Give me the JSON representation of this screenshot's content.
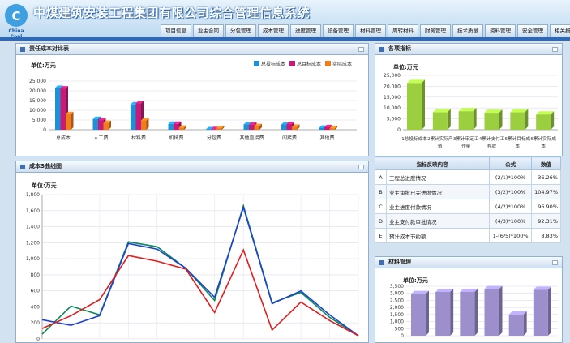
{
  "app": {
    "title": "中煤建筑安装工程集团有限公司综合管理信息系统",
    "logo_text": "China Coal"
  },
  "nav": {
    "tabs": [
      "项目信息",
      "业主合同",
      "分包管理",
      "成本管理",
      "进度管理",
      "设备管理",
      "材料管理",
      "周转材料",
      "财务管理",
      "技术质量",
      "资料管理",
      "安全管理",
      "相关报表"
    ]
  },
  "panels": {
    "cost_compare": {
      "title": "责任成本对比表",
      "unit": "单位:万元"
    },
    "indicators": {
      "title": "各项指标",
      "unit": "单位:万元"
    },
    "scurve": {
      "title": "成本S曲线图",
      "unit": "单位:万元"
    },
    "materials": {
      "title": "材料管理",
      "unit": "单位:万元"
    }
  },
  "table": {
    "headers": [
      "指标反映内容",
      "公式",
      "数值"
    ],
    "rows": [
      [
        "A",
        "工程总进度情况",
        "(2/1)*100%",
        "36.26%"
      ],
      [
        "B",
        "业主审批已完进度情况",
        "(3/2)*100%",
        "104.97%"
      ],
      [
        "C",
        "业主进度付款情况",
        "(4/2)*100%",
        "96.90%"
      ],
      [
        "D",
        "业主支付款审批情况",
        "(4/3)*100%",
        "92.31%"
      ],
      [
        "E",
        "预计成本节约额",
        "1-(6/5)*100%",
        "8.83%"
      ]
    ]
  },
  "chart_data": [
    {
      "type": "bar",
      "legend": [
        "总投标成本",
        "总目标成本",
        "实际成本"
      ],
      "colors": [
        "#1e90d6",
        "#c81a78",
        "#f07c1e"
      ],
      "categories": [
        "总成本",
        "人工费",
        "材料费",
        "机械费",
        "分包费",
        "其他直接费",
        "间接费",
        "其他费"
      ],
      "series": [
        {
          "name": "总投标成本",
          "values": [
            21500,
            5500,
            13000,
            3000,
            200,
            2700,
            2700,
            1000
          ]
        },
        {
          "name": "总目标成本",
          "values": [
            21200,
            4800,
            13600,
            3000,
            300,
            2500,
            2900,
            1300
          ]
        },
        {
          "name": "实际成本",
          "values": [
            8000,
            3500,
            4800,
            1000,
            800,
            1800,
            1500,
            800
          ]
        }
      ],
      "yticks": [
        "0",
        "5,000",
        "10,000",
        "15,000",
        "20,000",
        "25,000"
      ],
      "ylim": [
        0,
        25000
      ]
    },
    {
      "type": "bar",
      "categories": [
        "1总投标成本",
        "2累计实际产值",
        "3累计审定工作量",
        "4累计支付工程款",
        "5累计目标成本",
        "6累计实际成本"
      ],
      "values": [
        21500,
        8000,
        8500,
        7800,
        8000,
        7000
      ],
      "yticks": [
        "0",
        "5,000",
        "10,000",
        "15,000",
        "20,000",
        "25,000"
      ],
      "ylim": [
        0,
        25000
      ],
      "color": "#9ccf3f"
    },
    {
      "type": "line",
      "yticks": [
        "0",
        "200",
        "400",
        "600",
        "800",
        "1,000",
        "1,200",
        "1,400",
        "1,600",
        "1,800"
      ],
      "ylim": [
        0,
        1800
      ],
      "series": [
        {
          "color": "#0a8a55",
          "values": [
            60,
            410,
            300,
            1210,
            1150,
            880,
            480,
            1660,
            450,
            580,
            270,
            40
          ]
        },
        {
          "color": "#2040d0",
          "values": [
            240,
            170,
            290,
            1190,
            1120,
            880,
            520,
            1640,
            440,
            600,
            300,
            40
          ]
        },
        {
          "color": "#e01c1c",
          "values": [
            130,
            290,
            490,
            1040,
            970,
            870,
            330,
            1110,
            110,
            460,
            230,
            40
          ]
        }
      ]
    },
    {
      "type": "bar",
      "values": [
        2950,
        3100,
        3100,
        3300,
        1500,
        3250
      ],
      "yticks": [
        "0",
        "500",
        "1,000",
        "1,500",
        "2,000",
        "2,500",
        "3,000",
        "3,500"
      ],
      "ylim": [
        0,
        3500
      ],
      "color": "#9c8fcc"
    }
  ]
}
